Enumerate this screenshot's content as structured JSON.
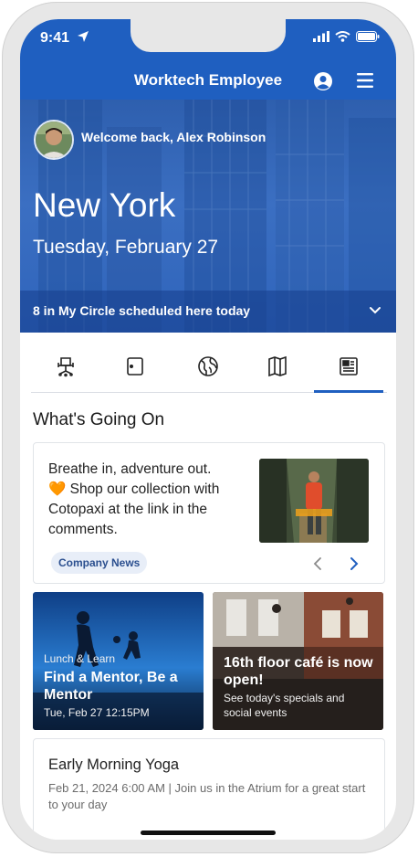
{
  "status_bar": {
    "time": "9:41"
  },
  "app_bar": {
    "title": "Worktech Employee"
  },
  "hero": {
    "welcome": "Welcome back, Alex Robinson",
    "city": "New York",
    "date": "Tuesday, February 27",
    "circle": "8 in My Circle scheduled here today"
  },
  "tabs": [
    {
      "icon": "desk-chair-icon",
      "active": false
    },
    {
      "icon": "door-icon",
      "active": false
    },
    {
      "icon": "globe-icon",
      "active": false
    },
    {
      "icon": "map-icon",
      "active": false
    },
    {
      "icon": "newspaper-icon",
      "active": true
    }
  ],
  "section_title": "What's Going On",
  "news": {
    "line1": "Breathe in, adventure out.",
    "line2": "🧡 Shop our collection with Cotopaxi at the link in the comments.",
    "badge": "Company News"
  },
  "tiles": [
    {
      "subtitle": "Lunch & Learn",
      "title": "Find a Mentor, Be a Mentor",
      "meta": "Tue, Feb 27 12:15PM"
    },
    {
      "title": "16th floor café is now open!",
      "meta": "See today's specials and social events"
    }
  ],
  "event": {
    "title": "Early Morning Yoga",
    "desc": "Feb 21, 2024 6:00 AM | Join us in the Atrium for a great start to your day"
  },
  "colors": {
    "brand": "#1f5fc0",
    "badge_bg": "#e8eef8"
  }
}
